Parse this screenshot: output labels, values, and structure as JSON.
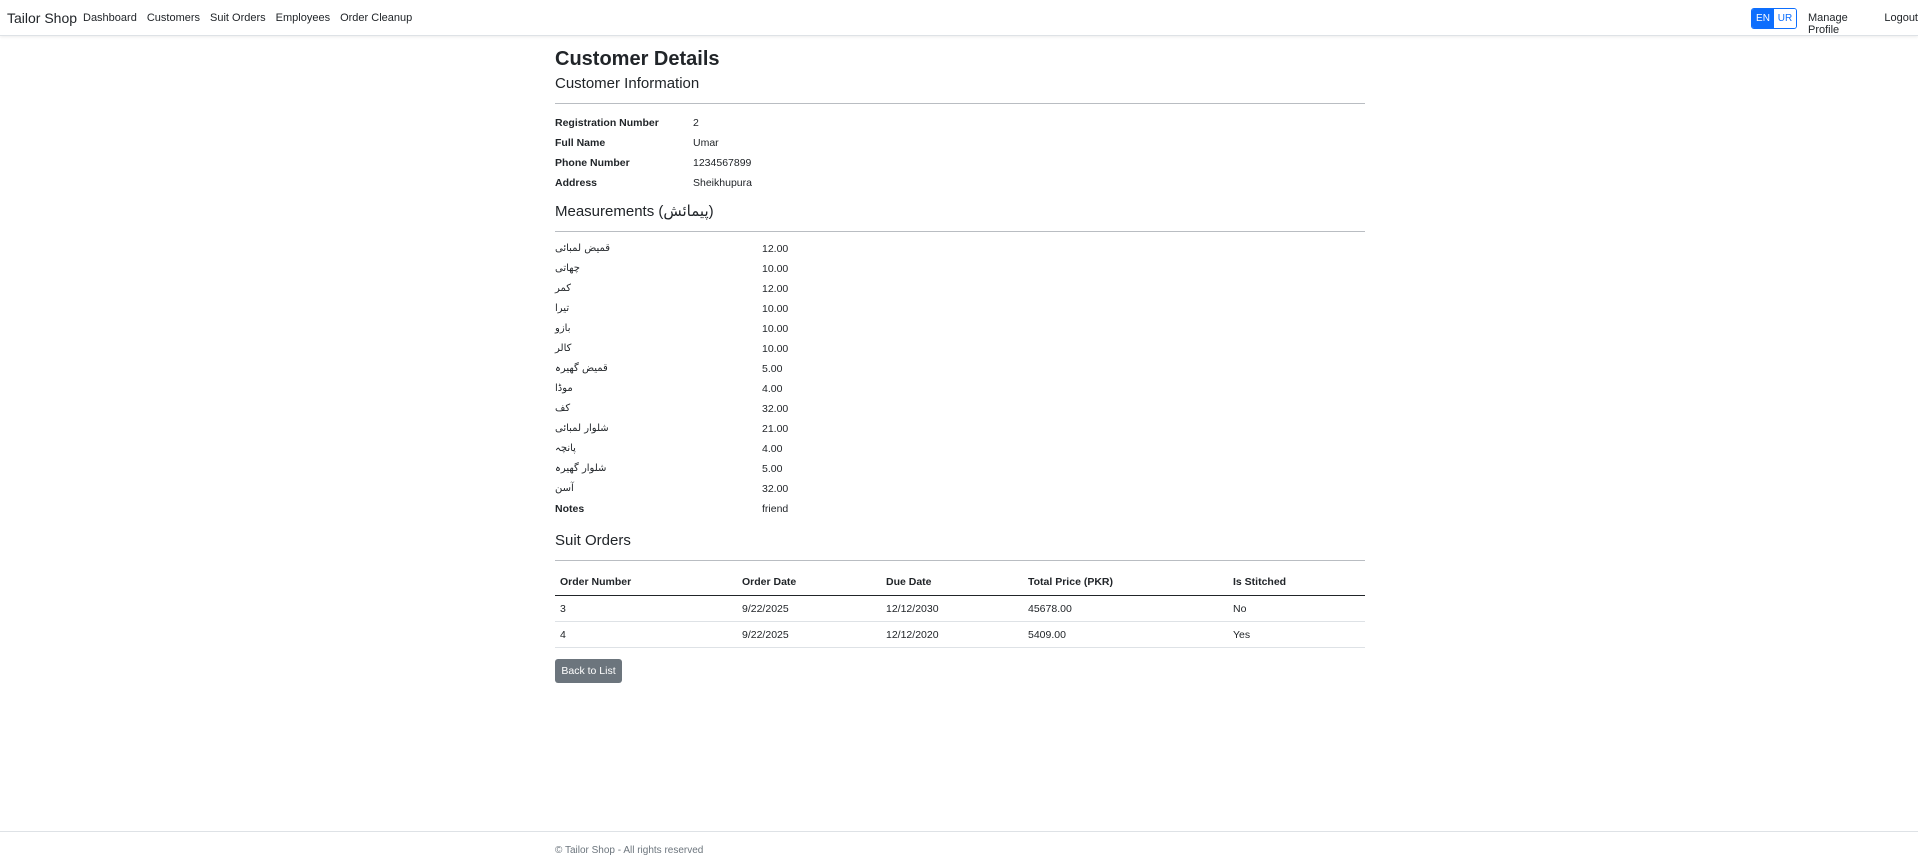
{
  "nav": {
    "brand": "Tailor Shop",
    "links": [
      "Dashboard",
      "Customers",
      "Suit Orders",
      "Employees",
      "Order Cleanup"
    ],
    "lang": [
      "EN",
      "UR"
    ],
    "manage_profile": "Manage Profile",
    "logout": "Logout"
  },
  "page": {
    "title": "Customer Details",
    "info_heading": "Customer Information",
    "info": [
      {
        "label": "Registration Number",
        "value": "2"
      },
      {
        "label": "Full Name",
        "value": "Umar"
      },
      {
        "label": "Phone Number",
        "value": "1234567899"
      },
      {
        "label": "Address",
        "value": "Sheikhupura"
      }
    ],
    "measurements_heading": "Measurements (پیمائش)",
    "measurements": [
      {
        "label": "قمیض لمبائی",
        "value": "12.00"
      },
      {
        "label": "چھاتی",
        "value": "10.00"
      },
      {
        "label": "کمر",
        "value": "12.00"
      },
      {
        "label": "تیرا",
        "value": "10.00"
      },
      {
        "label": "بازو",
        "value": "10.00"
      },
      {
        "label": "کالر",
        "value": "10.00"
      },
      {
        "label": "قمیض گھیرہ",
        "value": "5.00"
      },
      {
        "label": "موڈا",
        "value": "4.00"
      },
      {
        "label": "کف",
        "value": "32.00"
      },
      {
        "label": "شلوار لمبائی",
        "value": "21.00"
      },
      {
        "label": "پانچہ",
        "value": "4.00"
      },
      {
        "label": "شلوار گھیرہ",
        "value": "5.00"
      },
      {
        "label": "آسن",
        "value": "32.00"
      }
    ],
    "notes_label": "Notes",
    "notes_value": "friend",
    "orders_heading": "Suit Orders",
    "orders_columns": [
      "Order Number",
      "Order Date",
      "Due Date",
      "Total Price (PKR)",
      "Is Stitched"
    ],
    "orders": [
      [
        "3",
        "9/22/2025",
        "12/12/2030",
        "45678.00",
        "No"
      ],
      [
        "4",
        "9/22/2025",
        "12/12/2020",
        "5409.00",
        "Yes"
      ]
    ],
    "back_label": "Back to List"
  },
  "footer": {
    "text": "© Tailor Shop - All rights reserved"
  },
  "colors": {
    "primary": "#0d6efd",
    "secondary_button": "#6c757d"
  }
}
